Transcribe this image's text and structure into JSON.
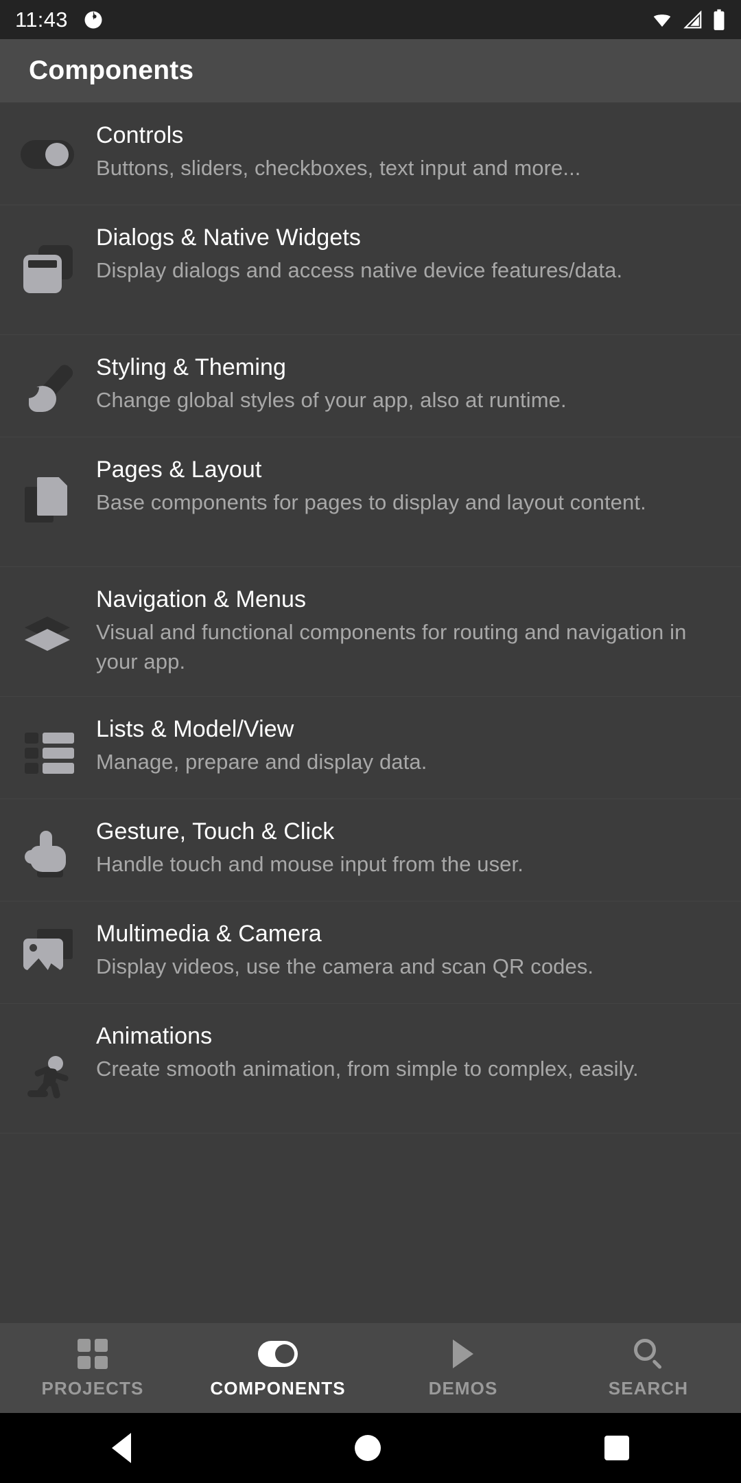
{
  "statusbar": {
    "time": "11:43",
    "icons": [
      "app-notification-icon",
      "wifi-icon",
      "cellular-signal-icon",
      "battery-icon"
    ]
  },
  "appbar": {
    "title": "Components"
  },
  "list": {
    "items": [
      {
        "icon": "toggle-switch-icon",
        "title": "Controls",
        "desc": "Buttons, sliders, checkboxes, text input and more..."
      },
      {
        "icon": "dialog-windows-icon",
        "title": "Dialogs & Native Widgets",
        "desc": "Display dialogs and access native device features/data."
      },
      {
        "icon": "paintbrush-icon",
        "title": "Styling & Theming",
        "desc": "Change global styles of your app, also at runtime."
      },
      {
        "icon": "pages-icon",
        "title": "Pages & Layout",
        "desc": "Base components for pages to display and layout content."
      },
      {
        "icon": "layers-icon",
        "title": "Navigation & Menus",
        "desc": "Visual and functional components for routing and navigation in your app."
      },
      {
        "icon": "list-rows-icon",
        "title": "Lists & Model/View",
        "desc": "Manage, prepare and display data."
      },
      {
        "icon": "pointing-hand-icon",
        "title": "Gesture, Touch & Click",
        "desc": "Handle touch and mouse input from the user."
      },
      {
        "icon": "image-media-icon",
        "title": "Multimedia & Camera",
        "desc": "Display videos, use the camera and scan QR codes."
      },
      {
        "icon": "running-person-icon",
        "title": "Animations",
        "desc": "Create smooth animation, from simple to complex, easily."
      }
    ]
  },
  "tabbar": {
    "tabs": [
      {
        "label": "PROJECTS",
        "icon": "grid-icon",
        "active": false
      },
      {
        "label": "COMPONENTS",
        "icon": "toggle-switch-icon",
        "active": true
      },
      {
        "label": "DEMOS",
        "icon": "play-icon",
        "active": false
      },
      {
        "label": "SEARCH",
        "icon": "search-icon",
        "active": false
      }
    ]
  },
  "navbar": {
    "back": "back-triangle-icon",
    "home": "home-circle-icon",
    "recents": "recents-square-icon"
  },
  "colors": {
    "status_bg": "#232323",
    "appbar_bg": "#4a4a4a",
    "list_bg": "#3c3c3c",
    "tabbar_bg": "#484848",
    "navbar_bg": "#000000",
    "title_text": "#ffffff",
    "desc_text": "#a8a8a8",
    "icon_light": "#adadb2",
    "icon_dark": "#2e2e2e",
    "tab_inactive": "#9a9a9a"
  }
}
